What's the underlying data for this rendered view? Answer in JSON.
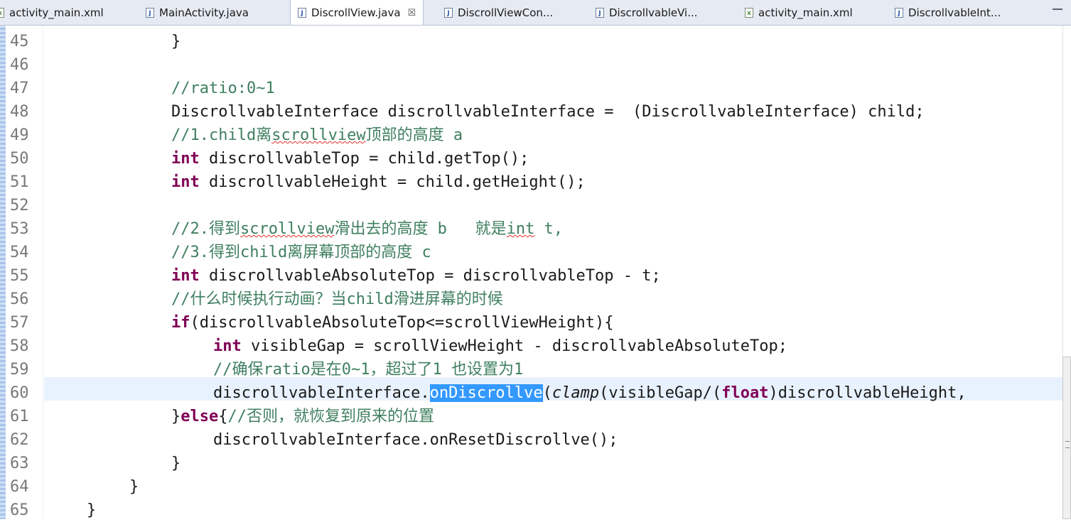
{
  "tabs": [
    {
      "label": "activity_main.xml",
      "icon": "xml-file-icon",
      "active": false
    },
    {
      "label": "MainActivity.java",
      "icon": "java-file-icon",
      "active": false
    },
    {
      "label": "DiscrollView.java",
      "icon": "java-file-icon",
      "active": true,
      "close": "☒"
    },
    {
      "label": "DiscrollViewCon...",
      "icon": "java-file-icon",
      "active": false
    },
    {
      "label": "DiscrollvableVi...",
      "icon": "java-file-icon",
      "active": false
    },
    {
      "label": "activity_main.xml",
      "icon": "xml-file-icon",
      "active": false
    },
    {
      "label": "DiscrollvableInt...",
      "icon": "java-file-icon",
      "active": false
    }
  ],
  "colors": {
    "keyword": "#7f0055",
    "comment": "#3f7f5f",
    "selection": "#3399ff",
    "current_line": "#e8f2fe"
  },
  "code": {
    "line_numbers": [
      "45",
      "46",
      "47",
      "48",
      "49",
      "50",
      "51",
      "52",
      "53",
      "54",
      "55",
      "56",
      "57",
      "58",
      "59",
      "60",
      "61",
      "62",
      "63",
      "64",
      "65"
    ],
    "l45": "}",
    "l47": "//ratio:0~1",
    "l48": "DiscrollvableInterface discrollvableInterface =  (DiscrollvableInterface) child;",
    "l49_a": "//1.child离",
    "l49_b": "scrollview",
    "l49_c": "顶部的高度 a",
    "l50_kw": "int",
    "l50_rest": " discrollvableTop = child.getTop();",
    "l51_kw": "int",
    "l51_rest": " discrollvableHeight = child.getHeight();",
    "l53_a": "//2.得到",
    "l53_b": "scrollview",
    "l53_c": "滑出去的高度 b   就是",
    "l53_d": "int",
    "l53_e": " t,",
    "l54": "//3.得到child离屏幕顶部的高度 c",
    "l55_kw": "int",
    "l55_rest": " discrollvableAbsoluteTop = discrollvableTop - t;",
    "l56": "//什么时候执行动画？当child滑进屏幕的时候",
    "l57_kw": "if",
    "l57_rest": "(discrollvableAbsoluteTop<=scrollViewHeight){",
    "l58_kw": "int",
    "l58_rest": " visibleGap = scrollViewHeight - discrollvableAbsoluteTop;",
    "l59": "//确保ratio是在0~1，超过了1 也设置为1",
    "l60_a": "discrollvableInterface.",
    "l60_sel": "onDiscrollve",
    "l60_b": "(",
    "l60_it": "clamp",
    "l60_c": "(visibleGap/(",
    "l60_kw": "float",
    "l60_d": ")discrollvableHeight,",
    "l61_a": "}",
    "l61_kw": "else",
    "l61_b": "{",
    "l61_cm": "//否则，就恢复到原来的位置",
    "l62": "discrollvableInterface.onResetDiscrollve();",
    "l63": "}",
    "l64": "}",
    "l65": "}"
  }
}
